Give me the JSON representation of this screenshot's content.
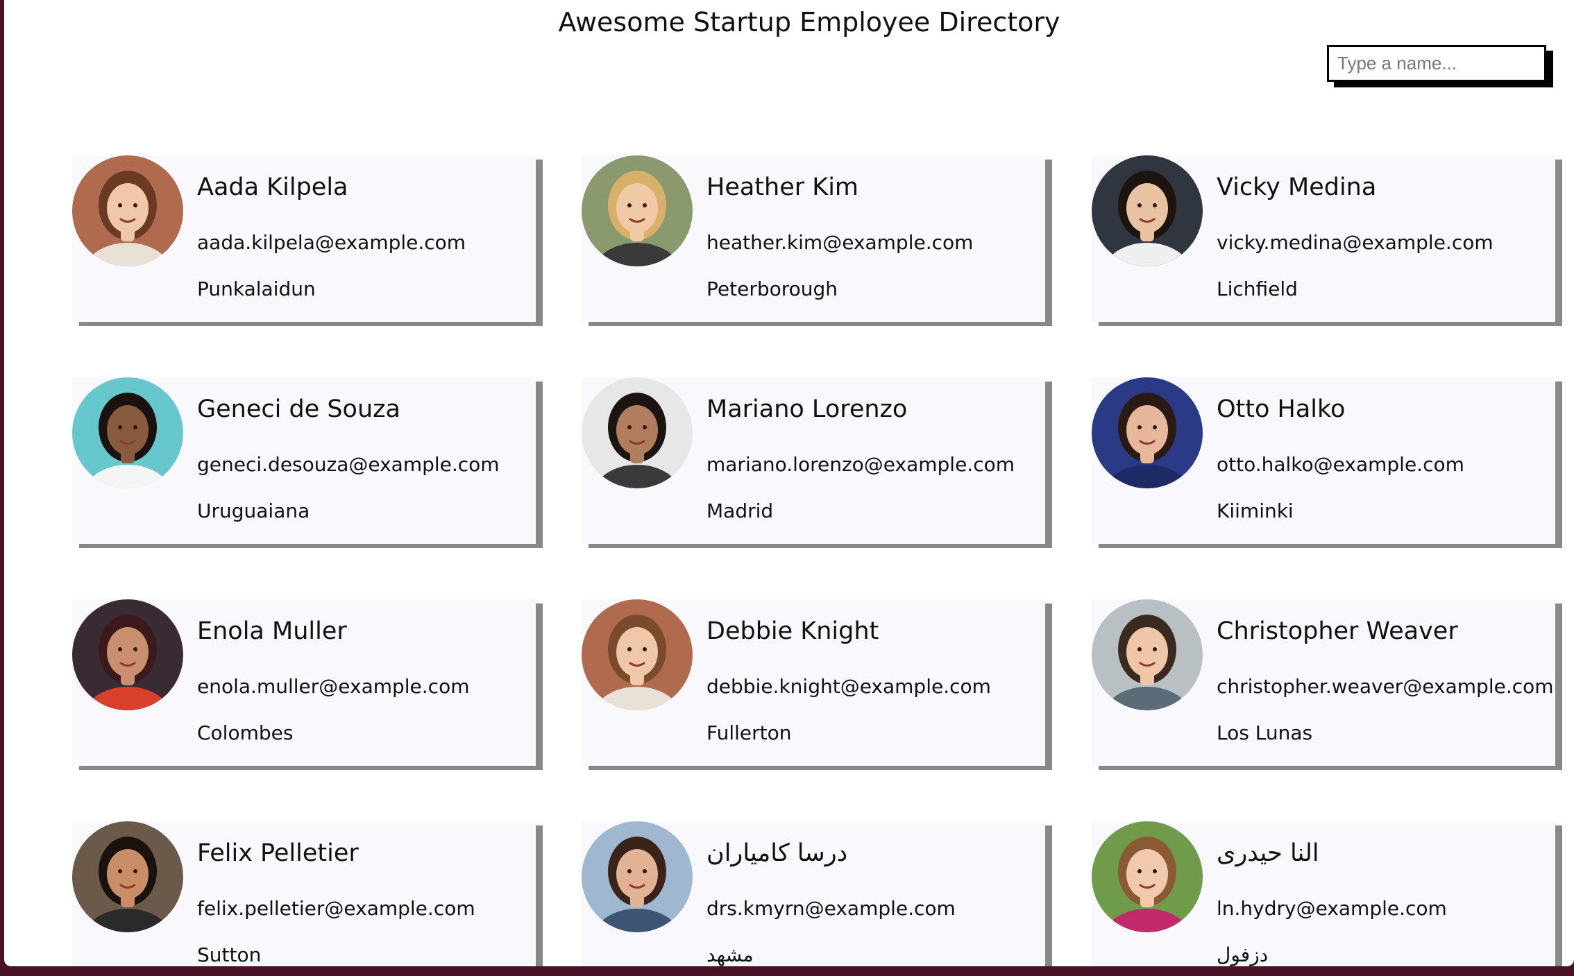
{
  "header": {
    "title": "Awesome Startup Employee Directory"
  },
  "search": {
    "placeholder": "Type a name...",
    "value": ""
  },
  "employees": [
    {
      "name": "Aada Kilpela",
      "email": "aada.kilpela@example.com",
      "city": "Punkalaidun",
      "avatar": {
        "bg": "#b06a4e",
        "skin": "#f0c7a8",
        "hair": "#6b3a22",
        "shirt": "#e9e0d6"
      }
    },
    {
      "name": "Heather Kim",
      "email": "heather.kim@example.com",
      "city": "Peterborough",
      "avatar": {
        "bg": "#8a9a6e",
        "skin": "#f1c9a6",
        "hair": "#d8b06a",
        "shirt": "#3a3a3a"
      }
    },
    {
      "name": "Vicky Medina",
      "email": "vicky.medina@example.com",
      "city": "Lichfield",
      "avatar": {
        "bg": "#2f3640",
        "skin": "#e9c2a2",
        "hair": "#1d1410",
        "shirt": "#efefef"
      }
    },
    {
      "name": "Geneci de Souza",
      "email": "geneci.desouza@example.com",
      "city": "Uruguaiana",
      "avatar": {
        "bg": "#66c8cc",
        "skin": "#8a5a3c",
        "hair": "#1a1210",
        "shirt": "#f4f4f4"
      }
    },
    {
      "name": "Mariano Lorenzo",
      "email": "mariano.lorenzo@example.com",
      "city": "Madrid",
      "avatar": {
        "bg": "#e7e7e7",
        "skin": "#b07e5e",
        "hair": "#1b1411",
        "shirt": "#3a3a3a"
      }
    },
    {
      "name": "Otto Halko",
      "email": "otto.halko@example.com",
      "city": "Kiiminki",
      "avatar": {
        "bg": "#2b3a86",
        "skin": "#e6b79a",
        "hair": "#2a1a12",
        "shirt": "#1d2a66"
      }
    },
    {
      "name": "Enola Muller",
      "email": "enola.muller@example.com",
      "city": "Colombes",
      "avatar": {
        "bg": "#3a2a33",
        "skin": "#c98f6e",
        "hair": "#3a1a1a",
        "shirt": "#d8402c"
      }
    },
    {
      "name": "Debbie Knight",
      "email": "debbie.knight@example.com",
      "city": "Fullerton",
      "avatar": {
        "bg": "#b06a4e",
        "skin": "#f0c7a8",
        "hair": "#7a4a2c",
        "shirt": "#e9e0d6"
      }
    },
    {
      "name": "Christopher Weaver",
      "email": "christopher.weaver@example.com",
      "city": "Los Lunas",
      "avatar": {
        "bg": "#b9c0c4",
        "skin": "#efc6a8",
        "hair": "#3a2a20",
        "shirt": "#5b6b78"
      }
    },
    {
      "name": "Felix Pelletier",
      "email": "felix.pelletier@example.com",
      "city": "Sutton",
      "avatar": {
        "bg": "#6b5a4a",
        "skin": "#c98e68",
        "hair": "#1a120e",
        "shirt": "#2a2a2a"
      }
    },
    {
      "name": "درسا کامیاران",
      "email": "drs.kmyrn@example.com",
      "city": "مشهد",
      "avatar": {
        "bg": "#9fb7cf",
        "skin": "#e1b394",
        "hair": "#3a2318",
        "shirt": "#3b5572"
      }
    },
    {
      "name": "النا حیدری",
      "email": "ln.hydry@example.com",
      "city": "دزفول",
      "avatar": {
        "bg": "#6f9b4a",
        "skin": "#f2c9ac",
        "hair": "#8a5a34",
        "shirt": "#c02a6a"
      }
    }
  ]
}
